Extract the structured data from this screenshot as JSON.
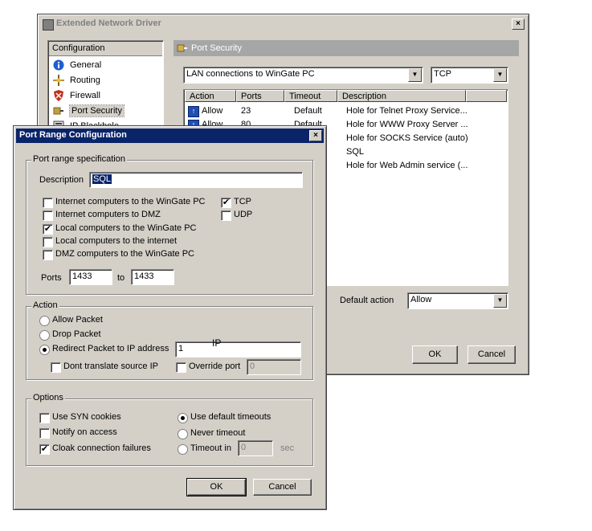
{
  "main_window": {
    "title": "Extended Network Driver",
    "close": "×",
    "tree": {
      "header": "Configuration",
      "items": [
        {
          "label": "General",
          "icon": "info-icon"
        },
        {
          "label": "Routing",
          "icon": "routing-icon"
        },
        {
          "label": "Firewall",
          "icon": "shield-icon"
        },
        {
          "label": "Port Security",
          "icon": "port-icon"
        },
        {
          "label": "IP Blackhole",
          "icon": "blackhole-icon"
        }
      ]
    },
    "panel_title": "Port Security",
    "connection_select": "LAN connections to WinGate PC",
    "protocol_select": "TCP",
    "table": {
      "columns": [
        "Action",
        "Ports",
        "Timeout",
        "Description"
      ],
      "rows": [
        {
          "action": "Allow",
          "ports": "23",
          "timeout": "Default",
          "description": "Hole for Telnet Proxy Service..."
        },
        {
          "action": "Allow",
          "ports": "80",
          "timeout": "Default",
          "description": "Hole for WWW Proxy Server ..."
        },
        {
          "action": "",
          "ports": "",
          "timeout": "",
          "description": "Hole for SOCKS Service (auto)"
        },
        {
          "action": "",
          "ports": "",
          "timeout": "",
          "description": "SQL"
        },
        {
          "action": "",
          "ports": "",
          "timeout": "",
          "description": "Hole for Web Admin service (..."
        }
      ]
    },
    "default_action_label": "Default action",
    "default_action_value": "Allow",
    "ok": "OK",
    "cancel": "Cancel"
  },
  "dialog": {
    "title": "Port Range Configuration",
    "close": "×",
    "spec_group": "Port range specification",
    "description_label": "Description",
    "description_value": "SQL",
    "source_checks": [
      {
        "label": "Internet computers to the WinGate PC",
        "checked": false
      },
      {
        "label": "Internet computers to DMZ",
        "checked": false
      },
      {
        "label": "Local computers to the WinGate PC",
        "checked": true
      },
      {
        "label": "Local computers to the internet",
        "checked": false
      },
      {
        "label": "DMZ computers to the WinGate PC",
        "checked": false
      }
    ],
    "protocol_checks": [
      {
        "label": "TCP",
        "checked": true
      },
      {
        "label": "UDP",
        "checked": false
      }
    ],
    "ports_label": "Ports",
    "ports_from": "1433",
    "to_label": "to",
    "ports_to": "1433",
    "action_group": "Action",
    "allow_packet": "Allow Packet",
    "drop_packet": "Drop Packet",
    "redirect_packet": "Redirect Packet to IP address",
    "ip_value": "1",
    "ip_overlay": "IP",
    "dont_translate": "Dont translate source IP",
    "override_port": "Override port",
    "override_value": "0",
    "options_group": "Options",
    "use_syn": "Use SYN cookies",
    "notify": "Notify on access",
    "cloak": "Cloak connection failures",
    "use_default_timeouts": "Use default timeouts",
    "never_timeout": "Never timeout",
    "timeout_in": "Timeout in",
    "timeout_value": "0",
    "sec": "sec",
    "ok": "OK",
    "cancel": "Cancel",
    "check_mark": "✔"
  }
}
